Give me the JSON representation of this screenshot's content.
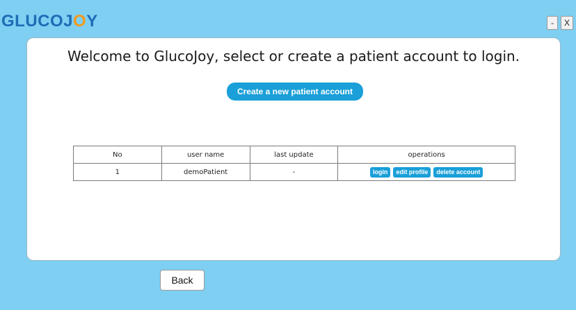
{
  "app": {
    "logo_part1": "GLUCOJ",
    "logo_accent": "O",
    "logo_part2": "Y",
    "minimize_label": "-",
    "close_label": "X"
  },
  "main": {
    "welcome_text": "Welcome to GlucoJoy, select or create a patient account to login.",
    "create_button_label": "Create a new patient account"
  },
  "table": {
    "headers": [
      "No",
      "user name",
      "last update",
      "operations"
    ],
    "rows": [
      {
        "no": "1",
        "user_name": "demoPatient",
        "last_update": "-",
        "operations": {
          "login": "login",
          "edit_profile": "edit profile",
          "delete_account": "delete account"
        }
      }
    ]
  },
  "footer": {
    "back_label": "Back"
  },
  "colors": {
    "background": "#7ecff2",
    "logo_blue": "#1e6db6",
    "logo_orange": "#f39a1e",
    "button_blue": "#1a9fd8"
  }
}
